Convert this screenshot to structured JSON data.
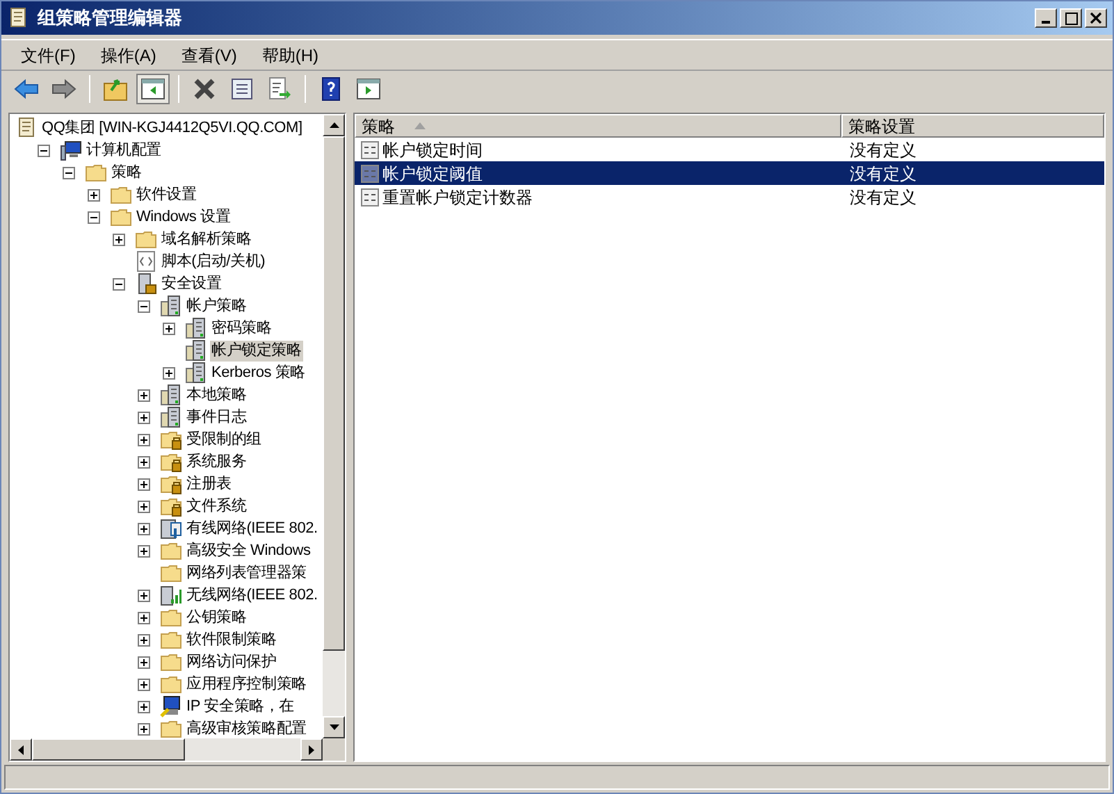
{
  "window": {
    "title": "组策略管理编辑器"
  },
  "menu": [
    "文件(F)",
    "操作(A)",
    "查看(V)",
    "帮助(H)"
  ],
  "toolbar": [
    {
      "kind": "back",
      "pressed": false
    },
    {
      "kind": "forward",
      "pressed": false
    },
    {
      "kind": "sep"
    },
    {
      "kind": "up",
      "pressed": false
    },
    {
      "kind": "tree",
      "pressed": true
    },
    {
      "kind": "sep"
    },
    {
      "kind": "delete",
      "pressed": false
    },
    {
      "kind": "properties",
      "pressed": false
    },
    {
      "kind": "export",
      "pressed": false
    },
    {
      "kind": "sep"
    },
    {
      "kind": "help",
      "pressed": false
    },
    {
      "kind": "action",
      "pressed": false
    }
  ],
  "tree": [
    {
      "label": "QQ集团 [WIN-KGJ4412Q5VI.QQ.COM]",
      "kind": "doc",
      "selected": false,
      "children": [
        {
          "label": "计算机配置",
          "kind": "computer",
          "expanded": true,
          "selected": false,
          "children": [
            {
              "label": "策略",
              "kind": "folder",
              "expanded": true,
              "selected": false,
              "children": [
                {
                  "label": "软件设置",
                  "kind": "folder",
                  "expanded": false,
                  "selected": false
                },
                {
                  "label": "Windows 设置",
                  "kind": "folder",
                  "expanded": true,
                  "selected": false,
                  "children": [
                    {
                      "label": "域名解析策略",
                      "kind": "folder",
                      "expanded": false,
                      "selected": false
                    },
                    {
                      "label": "脚本(启动/关机)",
                      "kind": "script",
                      "selected": false
                    },
                    {
                      "label": "安全设置",
                      "kind": "secure",
                      "expanded": true,
                      "selected": false,
                      "children": [
                        {
                          "label": "帐户策略",
                          "kind": "policy",
                          "expanded": true,
                          "selected": false,
                          "children": [
                            {
                              "label": "密码策略",
                              "kind": "policy",
                              "expanded": false,
                              "selected": false
                            },
                            {
                              "label": "帐户锁定策略",
                              "kind": "policy",
                              "selected": true
                            },
                            {
                              "label": "Kerberos 策略",
                              "kind": "policy",
                              "expanded": false,
                              "selected": false
                            }
                          ]
                        },
                        {
                          "label": "本地策略",
                          "kind": "policy",
                          "expanded": false,
                          "selected": false
                        },
                        {
                          "label": "事件日志",
                          "kind": "policy",
                          "expanded": false,
                          "selected": false
                        },
                        {
                          "label": "受限制的组",
                          "kind": "lockfolder",
                          "expanded": false,
                          "selected": false
                        },
                        {
                          "label": "系统服务",
                          "kind": "lockfolder",
                          "expanded": false,
                          "selected": false
                        },
                        {
                          "label": "注册表",
                          "kind": "lockfolder",
                          "expanded": false,
                          "selected": false
                        },
                        {
                          "label": "文件系统",
                          "kind": "lockfolder",
                          "expanded": false,
                          "selected": false
                        },
                        {
                          "label": "有线网络(IEEE 802.",
                          "kind": "wired",
                          "expanded": false,
                          "selected": false
                        },
                        {
                          "label": "高级安全 Windows",
                          "kind": "folder",
                          "expanded": false,
                          "selected": false
                        },
                        {
                          "label": "网络列表管理器策",
                          "kind": "folder",
                          "selected": false
                        },
                        {
                          "label": "无线网络(IEEE 802.",
                          "kind": "wireless",
                          "expanded": false,
                          "selected": false
                        },
                        {
                          "label": "公钥策略",
                          "kind": "folder",
                          "expanded": false,
                          "selected": false
                        },
                        {
                          "label": "软件限制策略",
                          "kind": "folder",
                          "expanded": false,
                          "selected": false
                        },
                        {
                          "label": "网络访问保护",
                          "kind": "folder",
                          "expanded": false,
                          "selected": false
                        },
                        {
                          "label": "应用程序控制策略",
                          "kind": "folder",
                          "expanded": false,
                          "selected": false
                        },
                        {
                          "label": "IP 安全策略，在",
                          "kind": "ipsec",
                          "expanded": false,
                          "selected": false
                        },
                        {
                          "label": "高级审核策略配置",
                          "kind": "folder",
                          "expanded": false,
                          "selected": false
                        }
                      ]
                    }
                  ]
                }
              ]
            }
          ]
        }
      ]
    }
  ],
  "list": {
    "columns": [
      {
        "label": "策略",
        "sorted": true
      },
      {
        "label": "策略设置",
        "sorted": false
      }
    ],
    "rows": [
      {
        "policy": "帐户锁定时间",
        "setting": "没有定义",
        "selected": false
      },
      {
        "policy": "帐户锁定阈值",
        "setting": "没有定义",
        "selected": true
      },
      {
        "policy": "重置帐户锁定计数器",
        "setting": "没有定义",
        "selected": false
      }
    ]
  }
}
